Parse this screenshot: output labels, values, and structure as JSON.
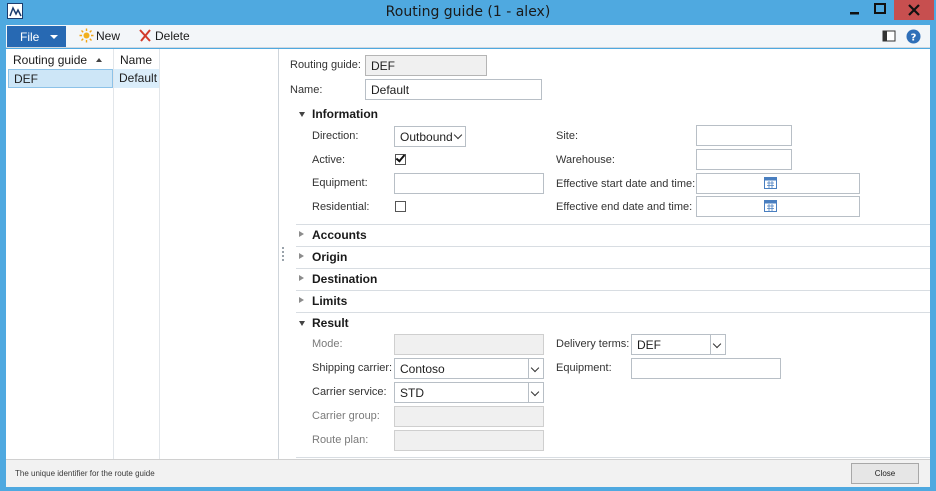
{
  "window": {
    "title": "Routing guide (1 - alex)"
  },
  "toolbar": {
    "file_label": "File",
    "new_label": "New",
    "delete_label": "Delete"
  },
  "grid": {
    "headers": [
      "Routing guide",
      "Name"
    ],
    "rows": [
      {
        "routing_guide": "DEF",
        "name": "Default"
      }
    ]
  },
  "header_fields": {
    "routing_guide_label": "Routing guide:",
    "routing_guide_value": "DEF",
    "name_label": "Name:",
    "name_value": "Default"
  },
  "sections": {
    "information": "Information",
    "accounts": "Accounts",
    "origin": "Origin",
    "destination": "Destination",
    "limits": "Limits",
    "result": "Result"
  },
  "information": {
    "direction_label": "Direction:",
    "direction_value": "Outbound",
    "active_label": "Active:",
    "active_checked": true,
    "equipment_label": "Equipment:",
    "equipment_value": "",
    "residential_label": "Residential:",
    "residential_checked": false,
    "site_label": "Site:",
    "site_value": "",
    "warehouse_label": "Warehouse:",
    "warehouse_value": "",
    "start_label": "Effective start date and time:",
    "start_value": "",
    "end_label": "Effective end date and time:",
    "end_value": ""
  },
  "result": {
    "mode_label": "Mode:",
    "mode_value": "",
    "carrier_label": "Shipping carrier:",
    "carrier_value": "Contoso",
    "service_label": "Carrier service:",
    "service_value": "STD",
    "group_label": "Carrier group:",
    "group_value": "",
    "route_label": "Route plan:",
    "route_value": "",
    "delivery_label": "Delivery terms:",
    "delivery_value": "DEF",
    "equipment_label": "Equipment:",
    "equipment_value": ""
  },
  "status": {
    "text": "The unique identifier for the route guide",
    "close_label": "Close"
  },
  "colors": {
    "titlebar": "#4fa9e0",
    "file_button": "#2769b3",
    "selection": "#cde6f7",
    "close_window": "#c74f4f"
  },
  "icons": [
    "app-icon",
    "minimize-icon",
    "maximize-icon",
    "close-icon",
    "new-icon",
    "delete-icon",
    "layout-icon",
    "help-icon",
    "calendar-icon"
  ]
}
